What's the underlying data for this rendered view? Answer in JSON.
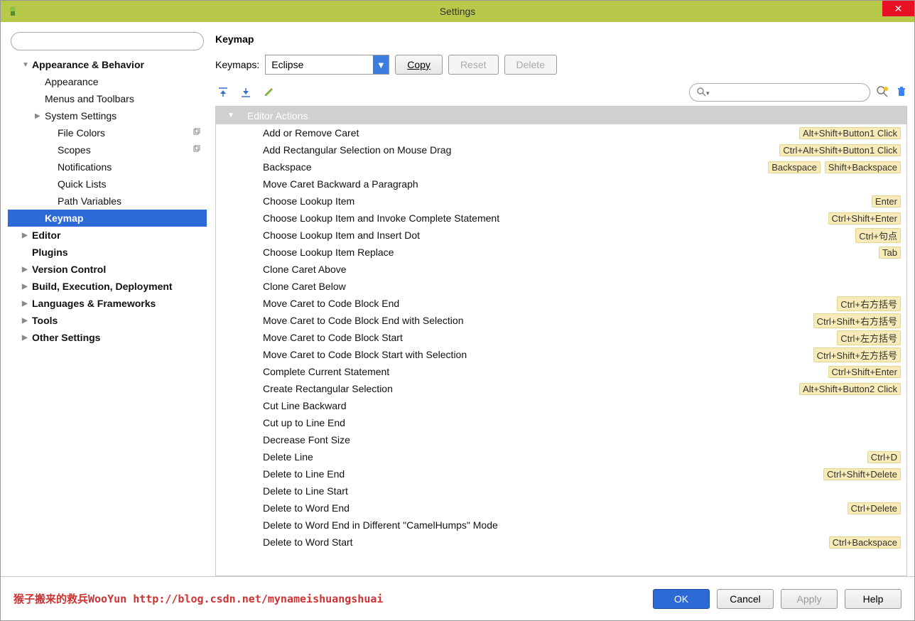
{
  "window": {
    "title": "Settings"
  },
  "sidebar": {
    "items": [
      {
        "label": "Appearance & Behavior",
        "bold": true,
        "expandable": true,
        "expanded": true,
        "level": 0
      },
      {
        "label": "Appearance",
        "level": 1
      },
      {
        "label": "Menus and Toolbars",
        "level": 1
      },
      {
        "label": "System Settings",
        "level": 1,
        "expandable": true,
        "expanded": false
      },
      {
        "label": "File Colors",
        "level": 2,
        "tailIcon": "copy"
      },
      {
        "label": "Scopes",
        "level": 2,
        "tailIcon": "copy"
      },
      {
        "label": "Notifications",
        "level": 2
      },
      {
        "label": "Quick Lists",
        "level": 2
      },
      {
        "label": "Path Variables",
        "level": 2
      },
      {
        "label": "Keymap",
        "level": 1,
        "selected": true,
        "bold": true
      },
      {
        "label": "Editor",
        "level": 0,
        "expandable": true,
        "bold": true
      },
      {
        "label": "Plugins",
        "level": 0,
        "bold": true
      },
      {
        "label": "Version Control",
        "level": 0,
        "expandable": true,
        "bold": true
      },
      {
        "label": "Build, Execution, Deployment",
        "level": 0,
        "expandable": true,
        "bold": true
      },
      {
        "label": "Languages & Frameworks",
        "level": 0,
        "expandable": true,
        "bold": true
      },
      {
        "label": "Tools",
        "level": 0,
        "expandable": true,
        "bold": true
      },
      {
        "label": "Other Settings",
        "level": 0,
        "expandable": true,
        "bold": true
      }
    ]
  },
  "main": {
    "heading": "Keymap",
    "keymapsLabel": "Keymaps:",
    "keymapsValue": "Eclipse",
    "copyLabel": "Copy",
    "resetLabel": "Reset",
    "deleteLabel": "Delete",
    "groupHeader": "Editor Actions",
    "actions": [
      {
        "name": "Add or Remove Caret",
        "shortcuts": [
          "Alt+Shift+Button1 Click"
        ]
      },
      {
        "name": "Add Rectangular Selection on Mouse Drag",
        "shortcuts": [
          "Ctrl+Alt+Shift+Button1 Click"
        ]
      },
      {
        "name": "Backspace",
        "shortcuts": [
          "Backspace",
          "Shift+Backspace"
        ]
      },
      {
        "name": "Move Caret Backward a Paragraph",
        "shortcuts": []
      },
      {
        "name": "Choose Lookup Item",
        "shortcuts": [
          "Enter"
        ]
      },
      {
        "name": "Choose Lookup Item and Invoke Complete Statement",
        "shortcuts": [
          "Ctrl+Shift+Enter"
        ]
      },
      {
        "name": "Choose Lookup Item and Insert Dot",
        "shortcuts": [
          "Ctrl+句点"
        ]
      },
      {
        "name": "Choose Lookup Item Replace",
        "shortcuts": [
          "Tab"
        ]
      },
      {
        "name": "Clone Caret Above",
        "shortcuts": []
      },
      {
        "name": "Clone Caret Below",
        "shortcuts": []
      },
      {
        "name": "Move Caret to Code Block End",
        "shortcuts": [
          "Ctrl+右方括号"
        ]
      },
      {
        "name": "Move Caret to Code Block End with Selection",
        "shortcuts": [
          "Ctrl+Shift+右方括号"
        ]
      },
      {
        "name": "Move Caret to Code Block Start",
        "shortcuts": [
          "Ctrl+左方括号"
        ]
      },
      {
        "name": "Move Caret to Code Block Start with Selection",
        "shortcuts": [
          "Ctrl+Shift+左方括号"
        ]
      },
      {
        "name": "Complete Current Statement",
        "shortcuts": [
          "Ctrl+Shift+Enter"
        ]
      },
      {
        "name": "Create Rectangular Selection",
        "shortcuts": [
          "Alt+Shift+Button2 Click"
        ]
      },
      {
        "name": "Cut Line Backward",
        "shortcuts": []
      },
      {
        "name": "Cut up to Line End",
        "shortcuts": []
      },
      {
        "name": "Decrease Font Size",
        "shortcuts": []
      },
      {
        "name": "Delete Line",
        "shortcuts": [
          "Ctrl+D"
        ]
      },
      {
        "name": "Delete to Line End",
        "shortcuts": [
          "Ctrl+Shift+Delete"
        ]
      },
      {
        "name": "Delete to Line Start",
        "shortcuts": []
      },
      {
        "name": "Delete to Word End",
        "shortcuts": [
          "Ctrl+Delete"
        ]
      },
      {
        "name": "Delete to Word End in Different \"CamelHumps\" Mode",
        "shortcuts": []
      },
      {
        "name": "Delete to Word Start",
        "shortcuts": [
          "Ctrl+Backspace"
        ]
      }
    ]
  },
  "footer": {
    "watermark": "猴子搬来的救兵WooYun http://blog.csdn.net/mynameishuangshuai",
    "ok": "OK",
    "cancel": "Cancel",
    "apply": "Apply",
    "help": "Help"
  }
}
